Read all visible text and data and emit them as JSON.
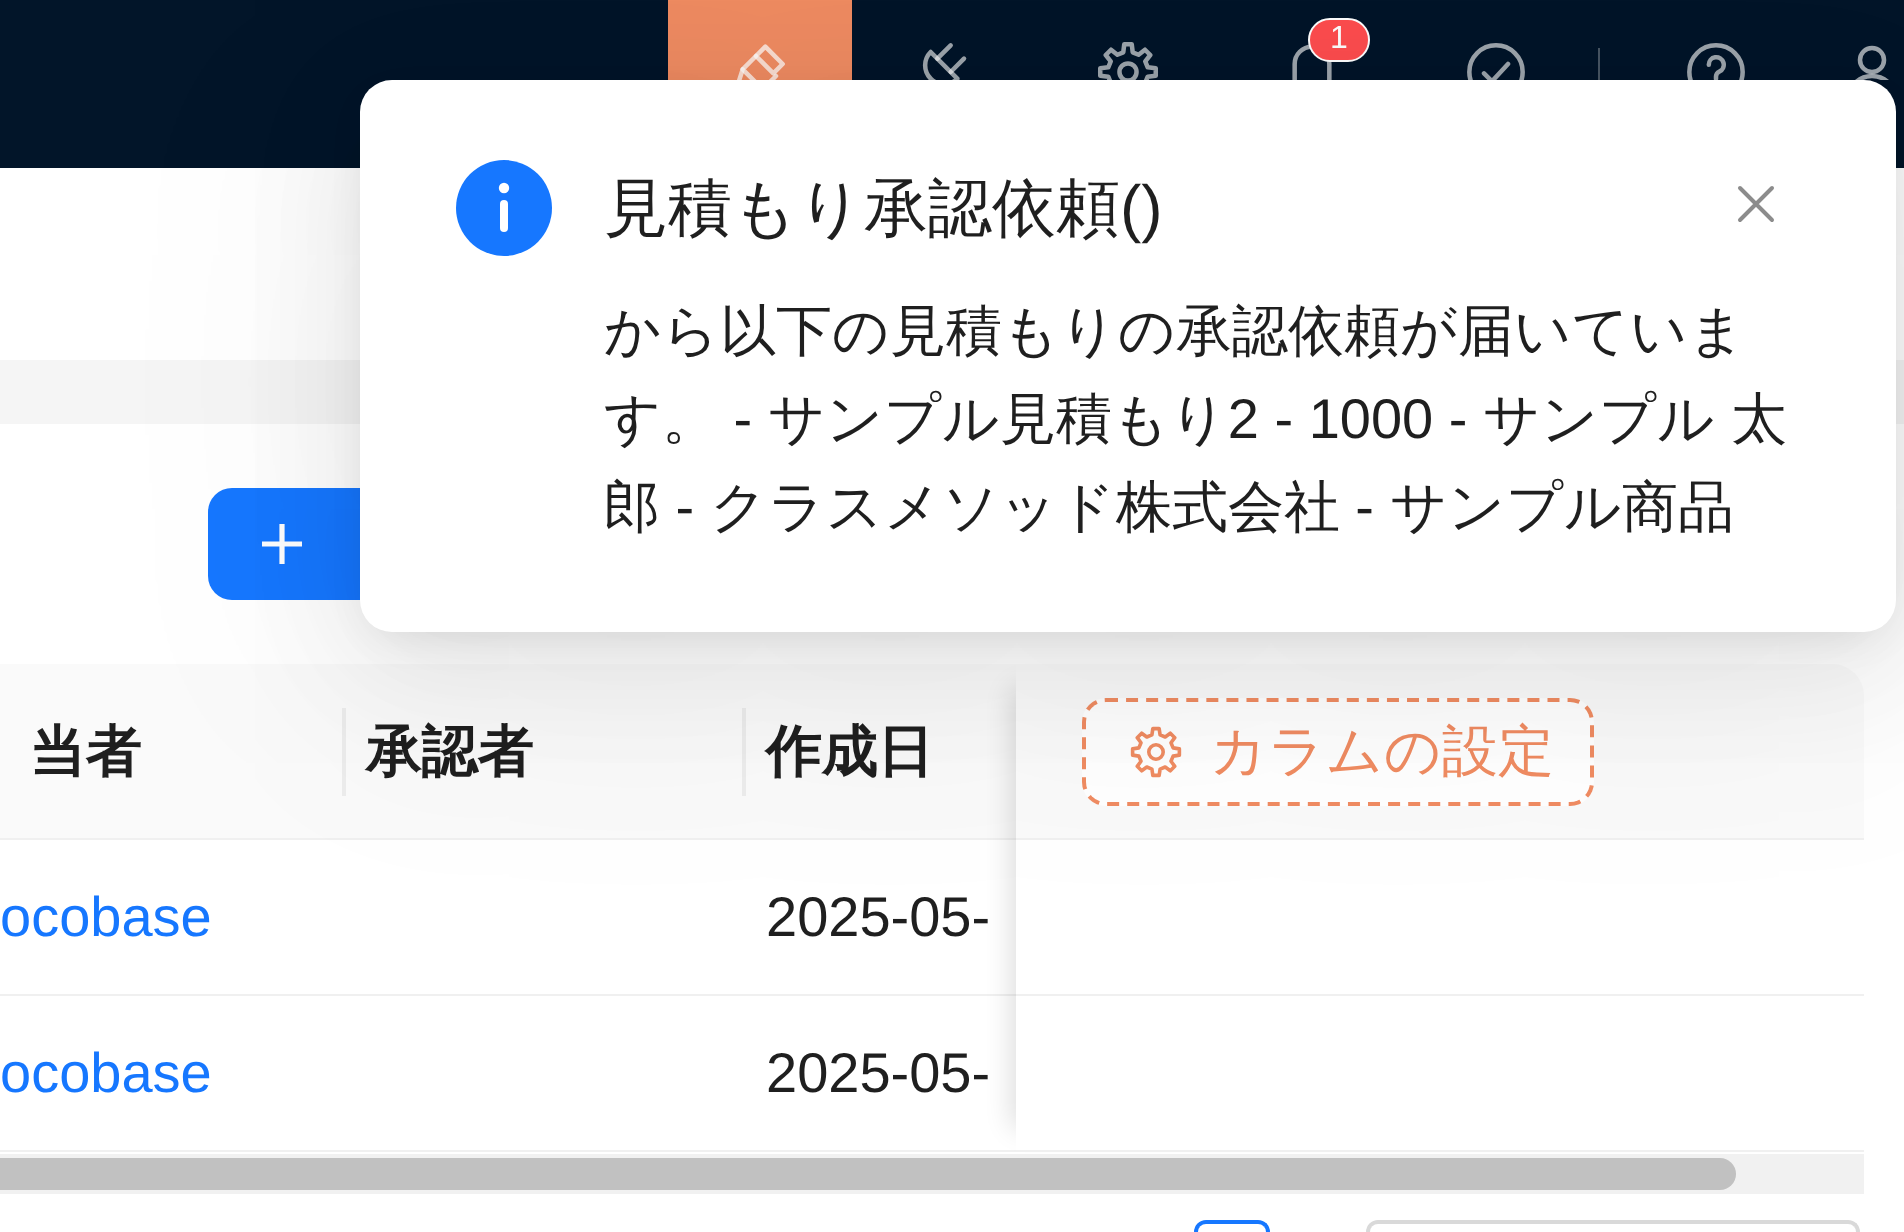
{
  "header": {
    "nav": [
      {
        "selected": true
      },
      {
        "selected": false
      },
      {
        "selected": false
      },
      {
        "selected": false,
        "badge": "1"
      },
      {
        "selected": false
      }
    ]
  },
  "notification": {
    "title": "見積もり承認依頼()",
    "message": "から以下の見積もりの承認依頼が届いています。 - サンプル見積もり2 - 1000 - サンプル 太郎 - クラスメソッド株式会社 - サンプル商品"
  },
  "table": {
    "columns": [
      "当者",
      "承認者",
      "作成日"
    ],
    "column_settings_button": {
      "label": "カラムの設定"
    },
    "rows": [
      {
        "assignee": "ocobase",
        "created_at": "2025-05-"
      },
      {
        "assignee": "ocobase",
        "created_at": "2025-05-"
      }
    ]
  }
}
